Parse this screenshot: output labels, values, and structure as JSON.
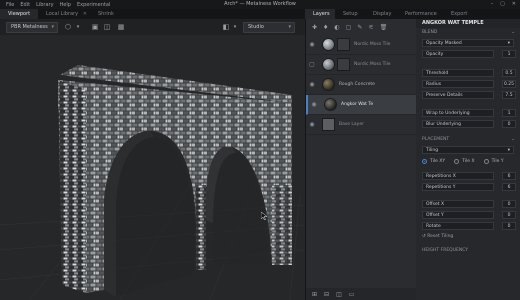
{
  "menubar": {
    "items": [
      "File",
      "Edit",
      "Library",
      "Help",
      "Experimental"
    ],
    "title": "Arch* — Metalness Workflow",
    "controls": [
      "–",
      "▢",
      "✕"
    ]
  },
  "viewport_tabs": [
    "Viewport",
    "Local Library",
    "Shrink"
  ],
  "viewport_toolbar": {
    "material_mode": "PBR Metalness",
    "environment": "Studio"
  },
  "layer_tabs": [
    "Layers",
    "Setup",
    "Display",
    "Performance",
    "Export"
  ],
  "layers": [
    {
      "name": "Nordic Moss Tile",
      "type": "sphere",
      "selected": false,
      "visible": true
    },
    {
      "name": "Nordic Moss Tile",
      "type": "sphere",
      "selected": false,
      "visible": false
    },
    {
      "name": "Rough Concrete",
      "type": "dark-sphere",
      "selected": false,
      "visible": true
    },
    {
      "name": "Angkor Wat Te",
      "type": "dark-sphere",
      "selected": true,
      "visible": true
    },
    {
      "name": "Base Layer",
      "type": "flat",
      "selected": false,
      "visible": true
    }
  ],
  "properties": {
    "title": "ANGKOR WAT TEMPLE",
    "blend_section": "BLEND",
    "blend_mode": "Opacity Masked",
    "opacity_label": "Opacity",
    "opacity_value": "1",
    "threshold_label": "Threshold",
    "threshold_value": "0.5",
    "radius_label": "Radius",
    "radius_value": "0.25",
    "preserve_label": "Preserve Details",
    "preserve_value": "7.5",
    "wrap_label": "Wrap to Underlying",
    "wrap_value": "1",
    "blur_label": "Blur Underlying",
    "blur_value": "0",
    "placement_section": "PLACEMENT",
    "tiling_mode": "Tiling",
    "tile_options": [
      "Tile XY",
      "Tile X",
      "Tile Y"
    ],
    "rep_x_label": "Repetitions X",
    "rep_x_value": "6",
    "rep_y_label": "Repetitions Y",
    "rep_y_value": "6",
    "offset_x_label": "Offset X",
    "offset_x_value": "0",
    "offset_y_label": "Offset Y",
    "offset_y_value": "0",
    "rotate_label": "Rotate",
    "rotate_value": "0",
    "reset_label": "Reset Tiling",
    "height_section": "HEIGHT FREQUENCY"
  },
  "colors": {
    "accent": "#4d7fc9",
    "panel": "#2a2c2f",
    "viewport": "#262729"
  }
}
